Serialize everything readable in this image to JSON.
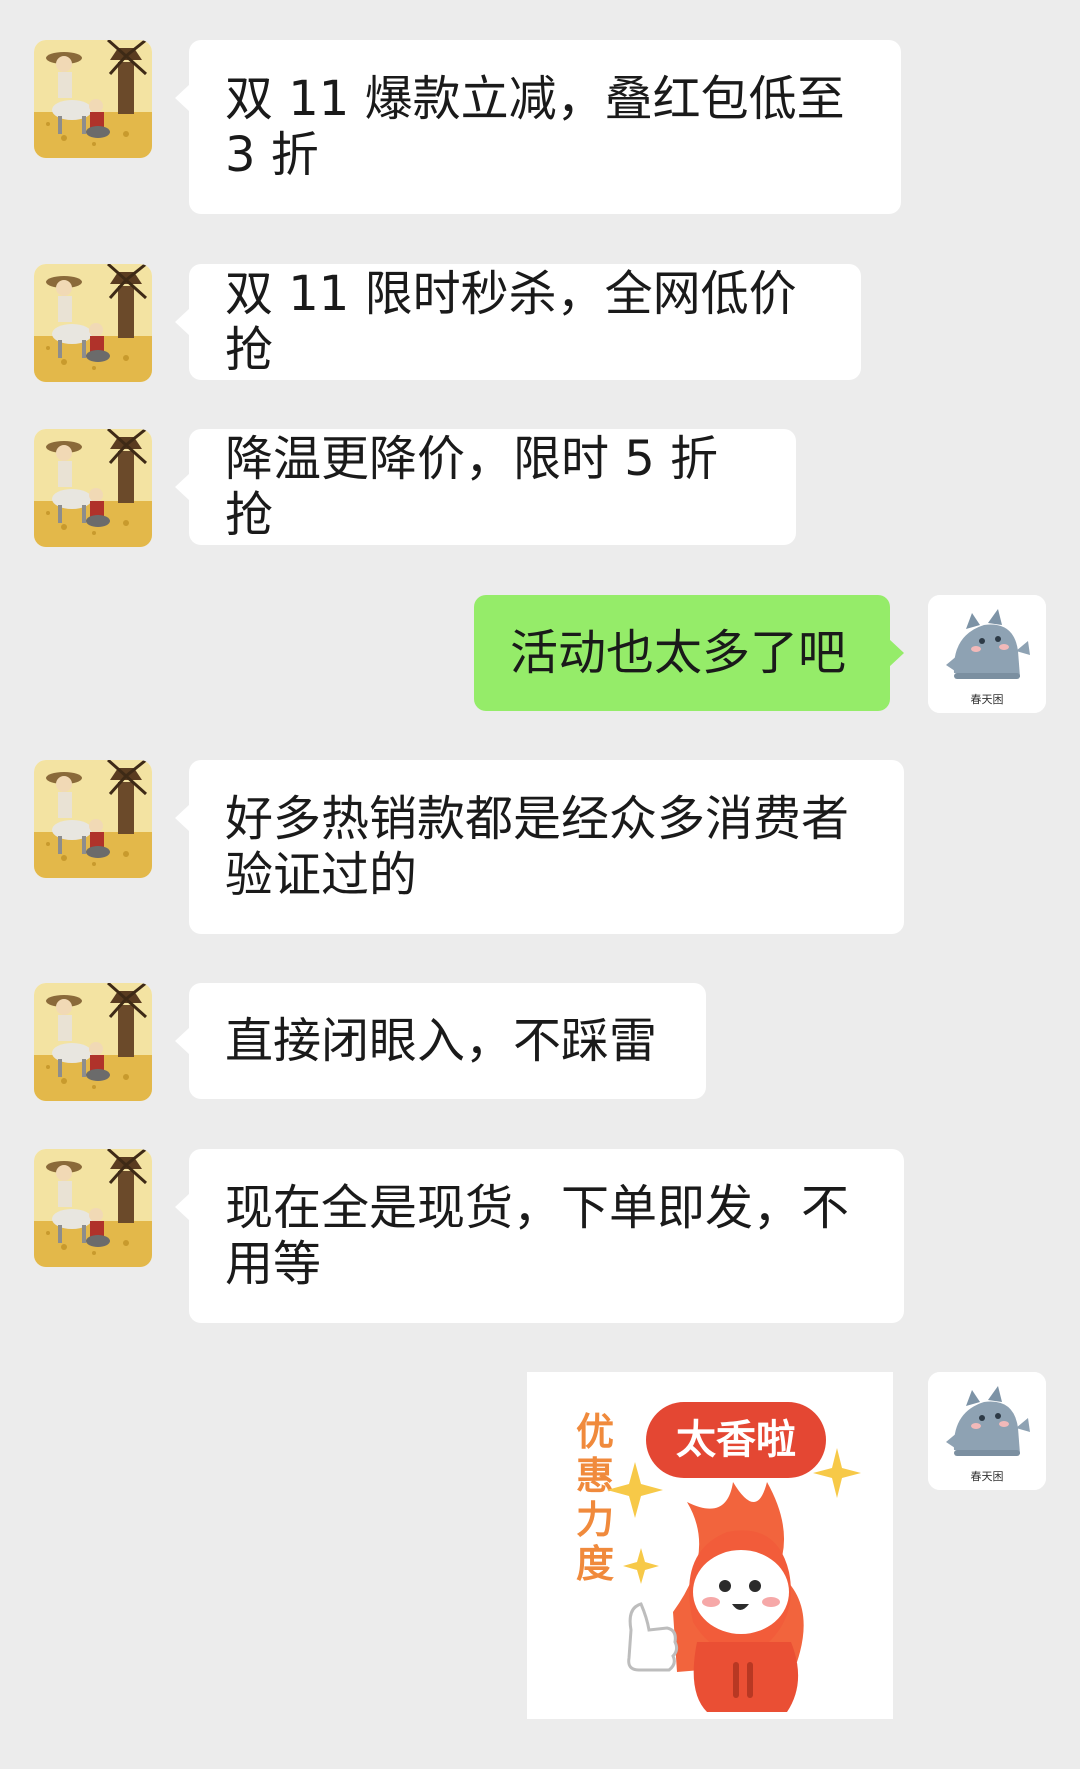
{
  "messages": [
    {
      "side": "left",
      "text": "双 11 爆款立减，叠红包低至 3 折"
    },
    {
      "side": "left",
      "text": "双 11 限时秒杀，全网低价抢"
    },
    {
      "side": "left",
      "text": "降温更降价，限时 5 折抢"
    },
    {
      "side": "right",
      "text": "活动也太多了吧"
    },
    {
      "side": "left",
      "text": "好多热销款都是经众多消费者验证过的"
    },
    {
      "side": "left",
      "text": "直接闭眼入，不踩雷"
    },
    {
      "side": "left",
      "text": "现在全是现货，下单即发，不用等"
    }
  ],
  "self_avatar": {
    "caption": "春天困",
    "icon": "gray-dragon-avatar-icon"
  },
  "other_avatar": {
    "icon": "windmill-riders-avatar-icon"
  },
  "sticker": {
    "badge": "太香啦",
    "vertical_text": "优惠力度",
    "icon": "fire-mascot-thumbs-up-icon"
  },
  "colors": {
    "background": "#ececec",
    "incoming_bubble": "#ffffff",
    "outgoing_bubble": "#95ec69",
    "badge": "#e44733",
    "vertical_text": "#f08a3c"
  }
}
